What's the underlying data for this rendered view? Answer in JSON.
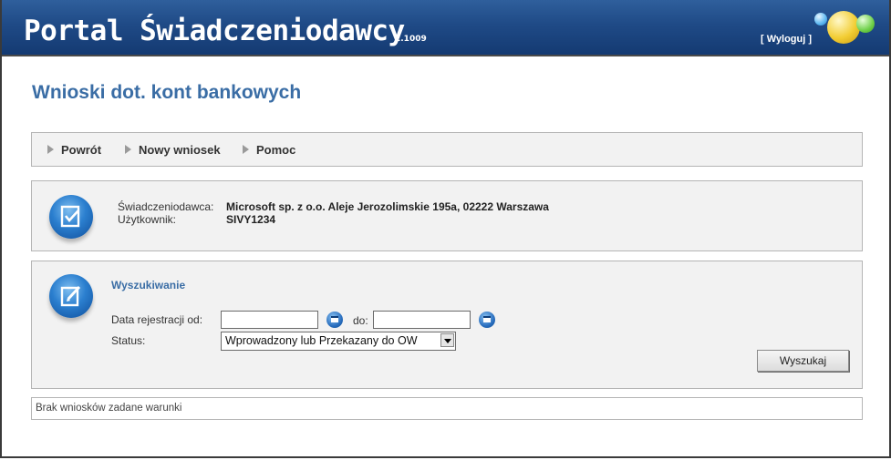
{
  "header": {
    "app_title": "Portal Świadczeniodawcy",
    "version": "2.1009",
    "logout_label": "[ Wyloguj ]"
  },
  "page": {
    "title": "Wnioski dot. kont bankowych"
  },
  "toolbar": {
    "items": [
      {
        "label": "Powrót"
      },
      {
        "label": "Nowy wniosek"
      },
      {
        "label": "Pomoc"
      }
    ]
  },
  "info": {
    "provider_label": "Świadczeniodawca:",
    "provider_value": "Microsoft sp. z o.o. Aleje Jerozolimskie 195a, 02222 Warszawa",
    "user_label": "Użytkownik:",
    "user_value": "SIVY1234"
  },
  "search": {
    "heading": "Wyszukiwanie",
    "date_from_label": "Data rejestracji od:",
    "date_from_value": "",
    "date_to_label": "do:",
    "date_to_value": "",
    "status_label": "Status:",
    "status_selected": "Wprowadzony lub Przekazany do OW",
    "search_button": "Wyszukaj"
  },
  "result": {
    "message": "Brak wniosków zadane warunki"
  },
  "colors": {
    "header_bg": "#1f4a86",
    "title_blue": "#3a6da5",
    "panel_bg": "#f2f2f2"
  },
  "icons": [
    "checkbox-document-icon",
    "edit-document-icon",
    "calendar-icon",
    "arrow-right-icon",
    "logo-bubbles-icon"
  ]
}
